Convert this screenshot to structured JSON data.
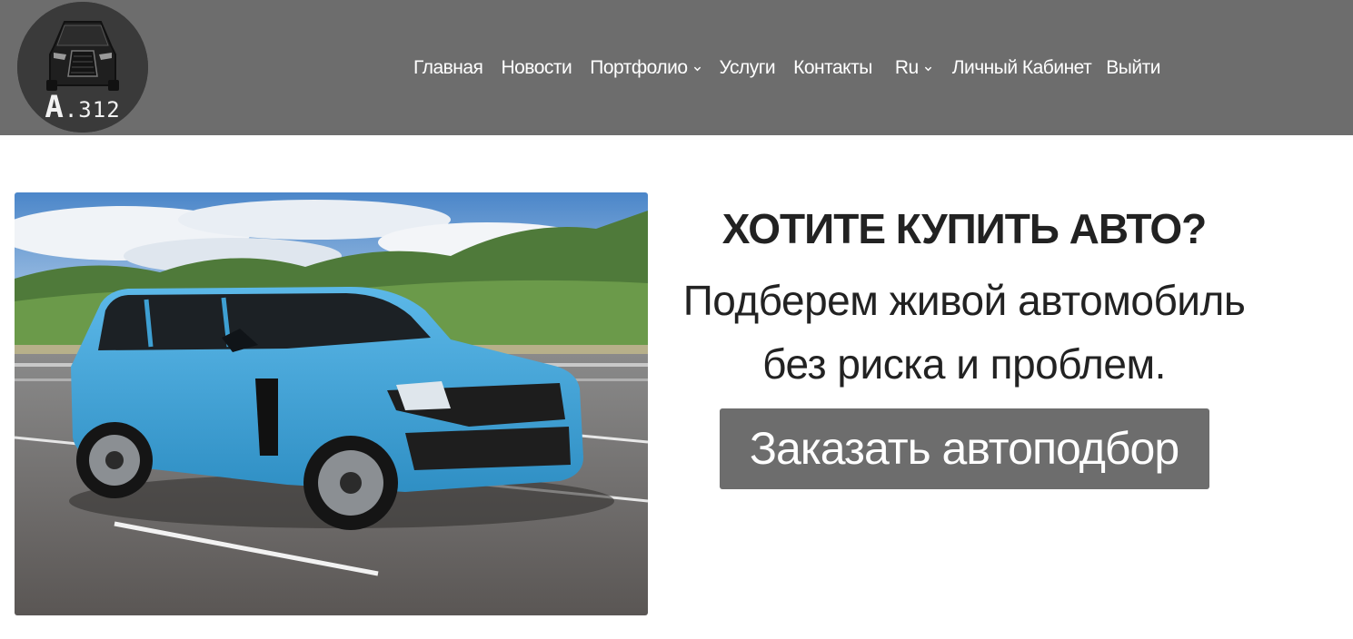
{
  "logo": {
    "main": "A",
    "suffix": ".312"
  },
  "nav": {
    "items": [
      {
        "label": "Главная",
        "dropdown": false
      },
      {
        "label": "Новости",
        "dropdown": false
      },
      {
        "label": "Портфолио",
        "dropdown": true
      },
      {
        "label": "Услуги",
        "dropdown": false
      },
      {
        "label": "Контакты",
        "dropdown": false
      }
    ],
    "language": "Ru",
    "cabinet": "Личный Кабинет",
    "logout": "Выйти"
  },
  "hero": {
    "title": "ХОТИТЕ КУПИТЬ АВТО?",
    "subtitle_line1": "Подберем живой автомобиль",
    "subtitle_line2": "без риска и проблем.",
    "cta": "Заказать автоподбор"
  },
  "colors": {
    "header_bg": "#6d6d6d",
    "button_bg": "#6d6d6d",
    "nav_text": "#ffffff",
    "car_blue": "#3ea0d3"
  }
}
